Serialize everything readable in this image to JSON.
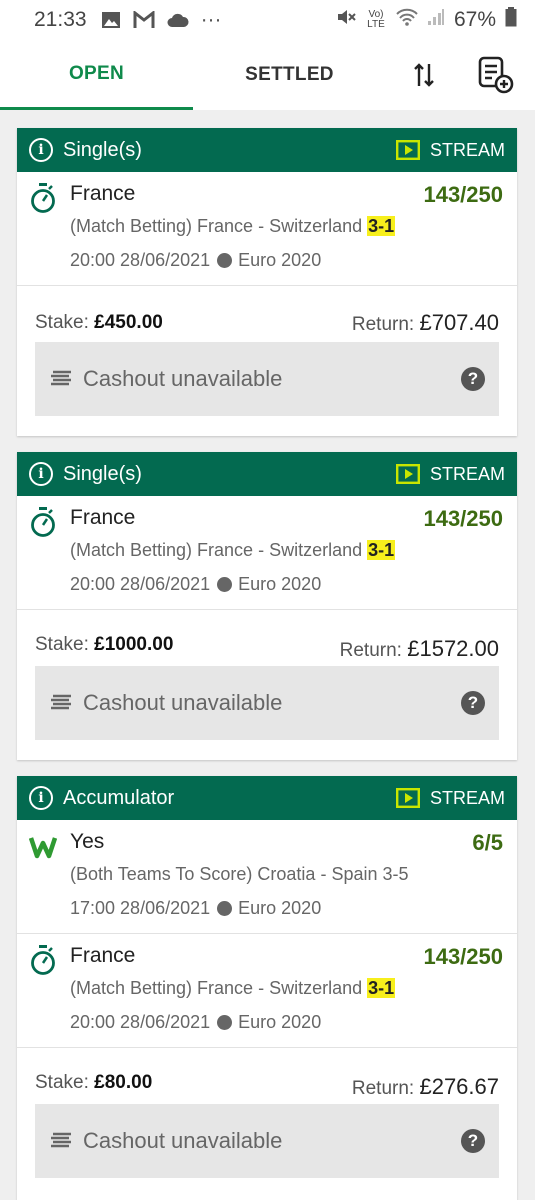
{
  "status_bar": {
    "time": "21:33",
    "more": "···",
    "network_label": "Vo) LTE",
    "battery": "67%"
  },
  "tabs": {
    "open": "OPEN",
    "settled": "SETTLED"
  },
  "bets": [
    {
      "header": {
        "info": "i",
        "title": "Single(s)",
        "stream": "STREAM"
      },
      "selections": [
        {
          "icon": "stopwatch-icon",
          "team": "France",
          "odds": "143/250",
          "market": "(Match Betting) France - Switzerland",
          "score": "3-1",
          "time": "20:00 28/06/2021",
          "competition": "Euro 2020"
        }
      ],
      "stake_label": "Stake:",
      "stake": "£450.00",
      "return_label": "Return:",
      "return": "£707.40",
      "cashout": "Cashout unavailable",
      "help": "?"
    },
    {
      "header": {
        "info": "i",
        "title": "Single(s)",
        "stream": "STREAM"
      },
      "selections": [
        {
          "icon": "stopwatch-icon",
          "team": "France",
          "odds": "143/250",
          "market": "(Match Betting) France - Switzerland",
          "score": "3-1",
          "time": "20:00 28/06/2021",
          "competition": "Euro 2020"
        }
      ],
      "stake_label": "Stake:",
      "stake": "£1000.00",
      "return_label": "Return:",
      "return": "£1572.00",
      "cashout": "Cashout unavailable",
      "help": "?"
    },
    {
      "header": {
        "info": "i",
        "title": "Accumulator",
        "stream": "STREAM"
      },
      "selections": [
        {
          "icon": "win-w-icon",
          "team": "Yes",
          "odds": "6/5",
          "market": "(Both Teams To Score) Croatia - Spain 3-5",
          "score": "",
          "time": "17:00 28/06/2021",
          "competition": "Euro 2020"
        },
        {
          "icon": "stopwatch-icon",
          "team": "France",
          "odds": "143/250",
          "market": "(Match Betting) France - Switzerland",
          "score": "3-1",
          "time": "20:00 28/06/2021",
          "competition": "Euro 2020"
        }
      ],
      "stake_label": "Stake:",
      "stake": "£80.00",
      "return_label": "Return:",
      "return": "£276.67",
      "cashout": "Cashout unavailable",
      "help": "?"
    }
  ],
  "colors": {
    "brand_green": "#036a50",
    "tab_active": "#0f8a4b",
    "odds": "#3d6b12",
    "score_highlight": "#f7ef1c",
    "stream_icon": "#c8e600"
  }
}
